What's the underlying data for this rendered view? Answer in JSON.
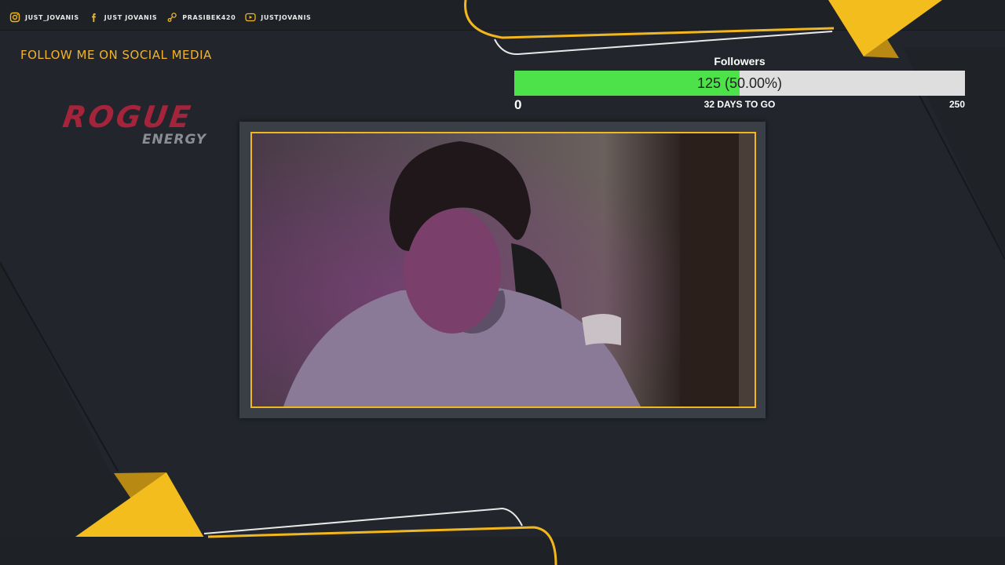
{
  "social": [
    {
      "icon": "instagram-icon",
      "label": "JUST_JOVANIS"
    },
    {
      "icon": "facebook-icon",
      "label": "JUST JOVANIS"
    },
    {
      "icon": "steam-icon",
      "label": "PRASIBEK420"
    },
    {
      "icon": "youtube-icon",
      "label": "JUSTJOVANIS"
    }
  ],
  "follow_title": "FOLLOW ME ON SOCIAL MEDIA",
  "logo": {
    "primary": "ROGUE",
    "secondary": "ENERGY"
  },
  "goal": {
    "title": "Followers",
    "current": 125,
    "target": 250,
    "progress_fraction": 0.5,
    "progress_text": "125 (50.00%)",
    "min_label": "0",
    "max_label": "250",
    "days_left": "32 DAYS TO GO"
  },
  "colors": {
    "background": "#22252b",
    "accent": "#f2b71e",
    "progress_fill": "#4ee24a",
    "progress_track": "#dedede",
    "logo_red": "#a4243b",
    "logo_gray": "#8a8d91"
  }
}
